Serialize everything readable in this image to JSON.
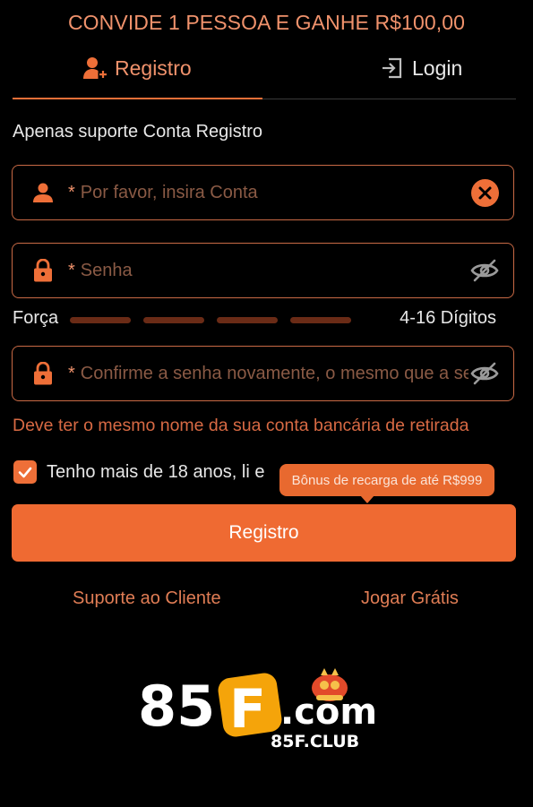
{
  "banner": {
    "text": "CONVIDE 1 PESSOA E GANHE R$100,00"
  },
  "tabs": [
    {
      "label": "Registro",
      "icon": "user-add-icon",
      "active": true
    },
    {
      "label": "Login",
      "icon": "login-icon",
      "active": false
    }
  ],
  "form": {
    "subtitle": "Apenas suporte Conta Registro",
    "account": {
      "value": "",
      "required_mark": "*",
      "placeholder": "Por favor, insira Conta",
      "lead_icon": "user-icon",
      "trail_icon": "clear-icon"
    },
    "password": {
      "value": "",
      "required_mark": "*",
      "placeholder": "Senha",
      "lead_icon": "lock-icon",
      "trail_icon": "eye-off-icon"
    },
    "strength": {
      "label": "Força",
      "digits_label": "4-16 Dígitos",
      "level": 0,
      "bar_color": "#6a2b16"
    },
    "confirm": {
      "value": "",
      "required_mark": "*",
      "placeholder": "Confirme a senha novamente, o mesmo que a senha",
      "lead_icon": "lock-icon",
      "trail_icon": "eye-off-icon"
    },
    "warning": "Deve ter o mesmo nome da sua conta bancária de retirada",
    "agree": {
      "checked": true,
      "text": "Tenho mais de 18 anos, li e"
    },
    "tooltip": "Bônus de recarga de até R$999",
    "submit_label": "Registro"
  },
  "links": {
    "support": "Suporte ao Cliente",
    "free_play": "Jogar Grátis"
  },
  "logo": {
    "main": "85F.com",
    "sub": "85F.CLUB"
  },
  "colors": {
    "accent": "#ef6a32",
    "accent_light": "#f0926c",
    "border": "#c96a45",
    "background": "#000000"
  }
}
